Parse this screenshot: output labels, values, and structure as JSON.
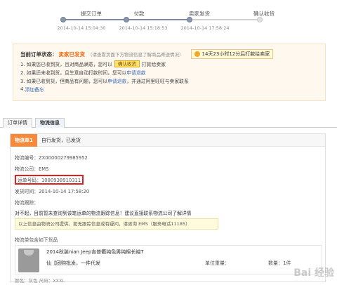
{
  "progress": {
    "steps": [
      {
        "label": "提交订单",
        "time": "2014-10-14 15:04:30",
        "done": true
      },
      {
        "label": "付款",
        "time": "2014-10-14 15:18:53",
        "done": true
      },
      {
        "label": "卖家发货",
        "time": "2014-10-14 17:58:24",
        "done": true
      },
      {
        "label": "确认收货",
        "time": "",
        "done": false
      }
    ]
  },
  "status": {
    "title": "当前订单状态：",
    "value": "卖家已发货",
    "hint": "（请查看页面下方物流信息了解商品寄送情况）",
    "timer": "14天23小时12分后打款给卖家",
    "line1_pre": "1. 如果您已收到货，且对商品满意，您可以",
    "confirm_btn": "确认收货",
    "line1_post": "打款给卖家",
    "line2_pre": "2. 如果还未收到货，且生意自动打款时间，您可以",
    "line2_link": "申请退款",
    "line3_pre": "3. 如果已收到货，但商品有问题，您可以",
    "line3_link": "申请退款",
    "line3_post": "，并通过阿里旺旺与卖家联系",
    "line4_pre": "4.",
    "line4_link": "添加备忘"
  },
  "tabs": [
    {
      "label": "订单详情"
    },
    {
      "label": "物流信息"
    }
  ],
  "shipment": {
    "tag": "物流单1",
    "tag_text": "自行发货，已发货",
    "number": "物流编号：ZX00000279985952",
    "company": "物流公司：EMS",
    "tracking": "运单号码：1080938910311",
    "ship_time": "发货时间：2014-10-14 17:58:20",
    "trace_label": "物流跟踪：",
    "trace_msg": "对不起，目前暂未查询到该笔运单的物流跟踪信息！建议直接联系物流公司了解详情",
    "notice": "以上信息由物流公司提供，如无跟踪信息或有疑问，请咨询 EMS（服务电话11185）",
    "contains": "物流单包含如下货品",
    "product": {
      "name": "2014秋装nian Jeep吉普衢纯色男纯棉长袖T",
      "seller": "仙【团购批发，一件代发",
      "price_label": "单位重量：",
      "qty_label": "数量：1件"
    },
    "attrs": "颜色：灰色   尺码：XXXL"
  },
  "watermark": "Bai 经验"
}
